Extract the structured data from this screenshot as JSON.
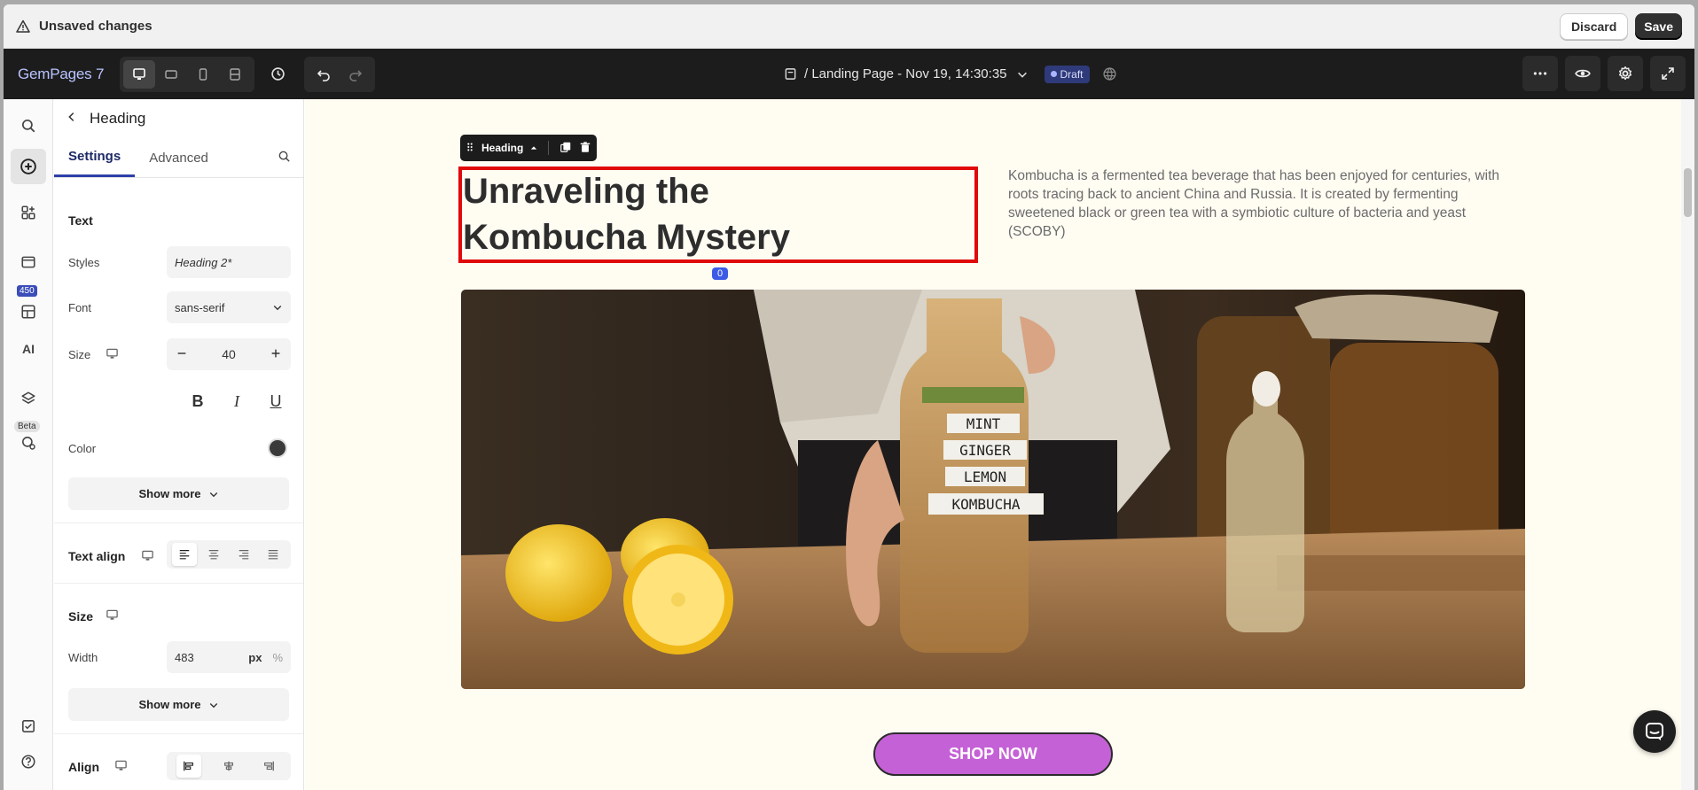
{
  "unsaved_bar": {
    "message": "Unsaved changes",
    "discard_label": "Discard",
    "save_label": "Save"
  },
  "toolbar": {
    "logo": "GemPages 7",
    "page_title": "/ Landing Page - Nov 19, 14:30:35",
    "status_badge": "Draft"
  },
  "rail": {
    "badge_count": "450",
    "beta_label": "Beta"
  },
  "panel": {
    "title": "Heading",
    "tabs": [
      "Settings",
      "Advanced"
    ],
    "text_section": "Text",
    "styles_label": "Styles",
    "styles_value": "Heading 2*",
    "font_label": "Font",
    "font_value": "sans-serif",
    "size_label": "Size",
    "size_value": "40",
    "color_label": "Color",
    "show_more": "Show more",
    "text_align_section": "Text align",
    "size_section": "Size",
    "width_label": "Width",
    "width_value": "483",
    "width_unit": "px",
    "width_unit_alt": "%",
    "align_section": "Align"
  },
  "canvas": {
    "element_toolbar_label": "Heading",
    "heading_line1": "Unraveling the",
    "heading_line2": "Kombucha Mystery",
    "index_badge": "0",
    "description": "Kombucha is a fermented tea beverage that has been enjoyed for centuries, with roots tracing back to ancient China and Russia. It is created by fermenting sweetened black or green tea with a symbiotic culture of bacteria and yeast (SCOBY)",
    "bottle_labels": [
      "MINT",
      "GINGER",
      "LEMON",
      "KOMBUCHA"
    ],
    "cta_label": "SHOP NOW"
  },
  "colors": {
    "selection": "#e00a0a",
    "cta": "#c561d6",
    "canvas_bg": "#fffcf2",
    "brand_accent": "#2e3fa8"
  }
}
